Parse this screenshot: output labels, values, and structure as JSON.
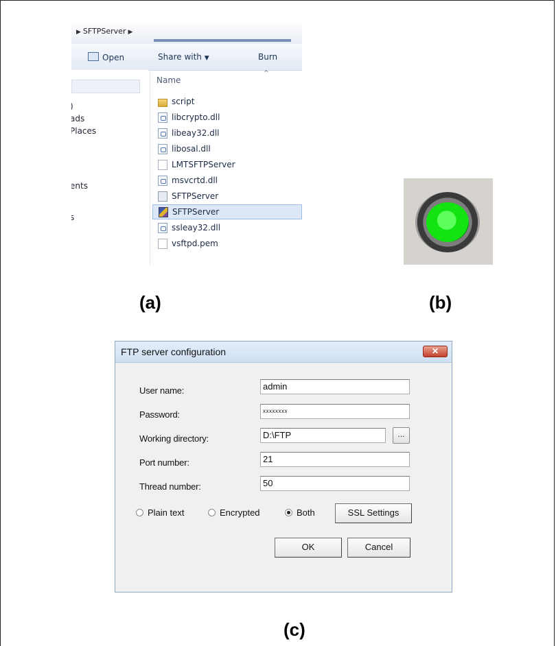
{
  "explorer": {
    "breadcrumb": "SFTPServer",
    "toolbar": {
      "open": "Open",
      "share_with": "Share with",
      "share_arrow": "▼",
      "burn": "Burn"
    },
    "nav_items": [
      ")",
      "ads",
      "Places",
      "ents",
      "s"
    ],
    "column_header": "Name",
    "sort_caret": "^",
    "files": [
      {
        "name": "script",
        "icon": "folder-icon"
      },
      {
        "name": "libcrypto.dll",
        "icon": "dll-file-icon"
      },
      {
        "name": "libeay32.dll",
        "icon": "dll-file-icon"
      },
      {
        "name": "libosal.dll",
        "icon": "dll-file-icon"
      },
      {
        "name": "LMTSFTPServer",
        "icon": "document-icon"
      },
      {
        "name": "msvcrtd.dll",
        "icon": "dll-file-icon"
      },
      {
        "name": "SFTPServer",
        "icon": "app-file-icon"
      },
      {
        "name": "SFTPServer",
        "icon": "executable-icon",
        "selected": true
      },
      {
        "name": "ssleay32.dll",
        "icon": "dll-file-icon"
      },
      {
        "name": "vsftpd.pem",
        "icon": "document-icon"
      }
    ]
  },
  "status_led": {
    "state": "on",
    "color": "#13e313",
    "icon": "green-status-light-icon"
  },
  "captions": {
    "a": "(a)",
    "b": "(b)",
    "c": "(c)"
  },
  "dialog": {
    "title": "FTP server configuration",
    "close_glyph": "✕",
    "fields": {
      "user_name": {
        "label": "User name:",
        "value": "admin"
      },
      "password": {
        "label": "Password:",
        "value": "xxxxxxxx"
      },
      "working_directory": {
        "label": "Working directory:",
        "value": "D:\\FTP"
      },
      "port_number": {
        "label": "Port number:",
        "value": "21"
      },
      "thread_number": {
        "label": "Thread number:",
        "value": "50"
      }
    },
    "browse_label": "...",
    "radios": [
      {
        "label": "Plain text",
        "checked": false
      },
      {
        "label": "Encrypted",
        "checked": false
      },
      {
        "label": "Both",
        "checked": true
      }
    ],
    "buttons": {
      "ssl_settings": "SSL Settings",
      "ok": "OK",
      "cancel": "Cancel"
    }
  }
}
